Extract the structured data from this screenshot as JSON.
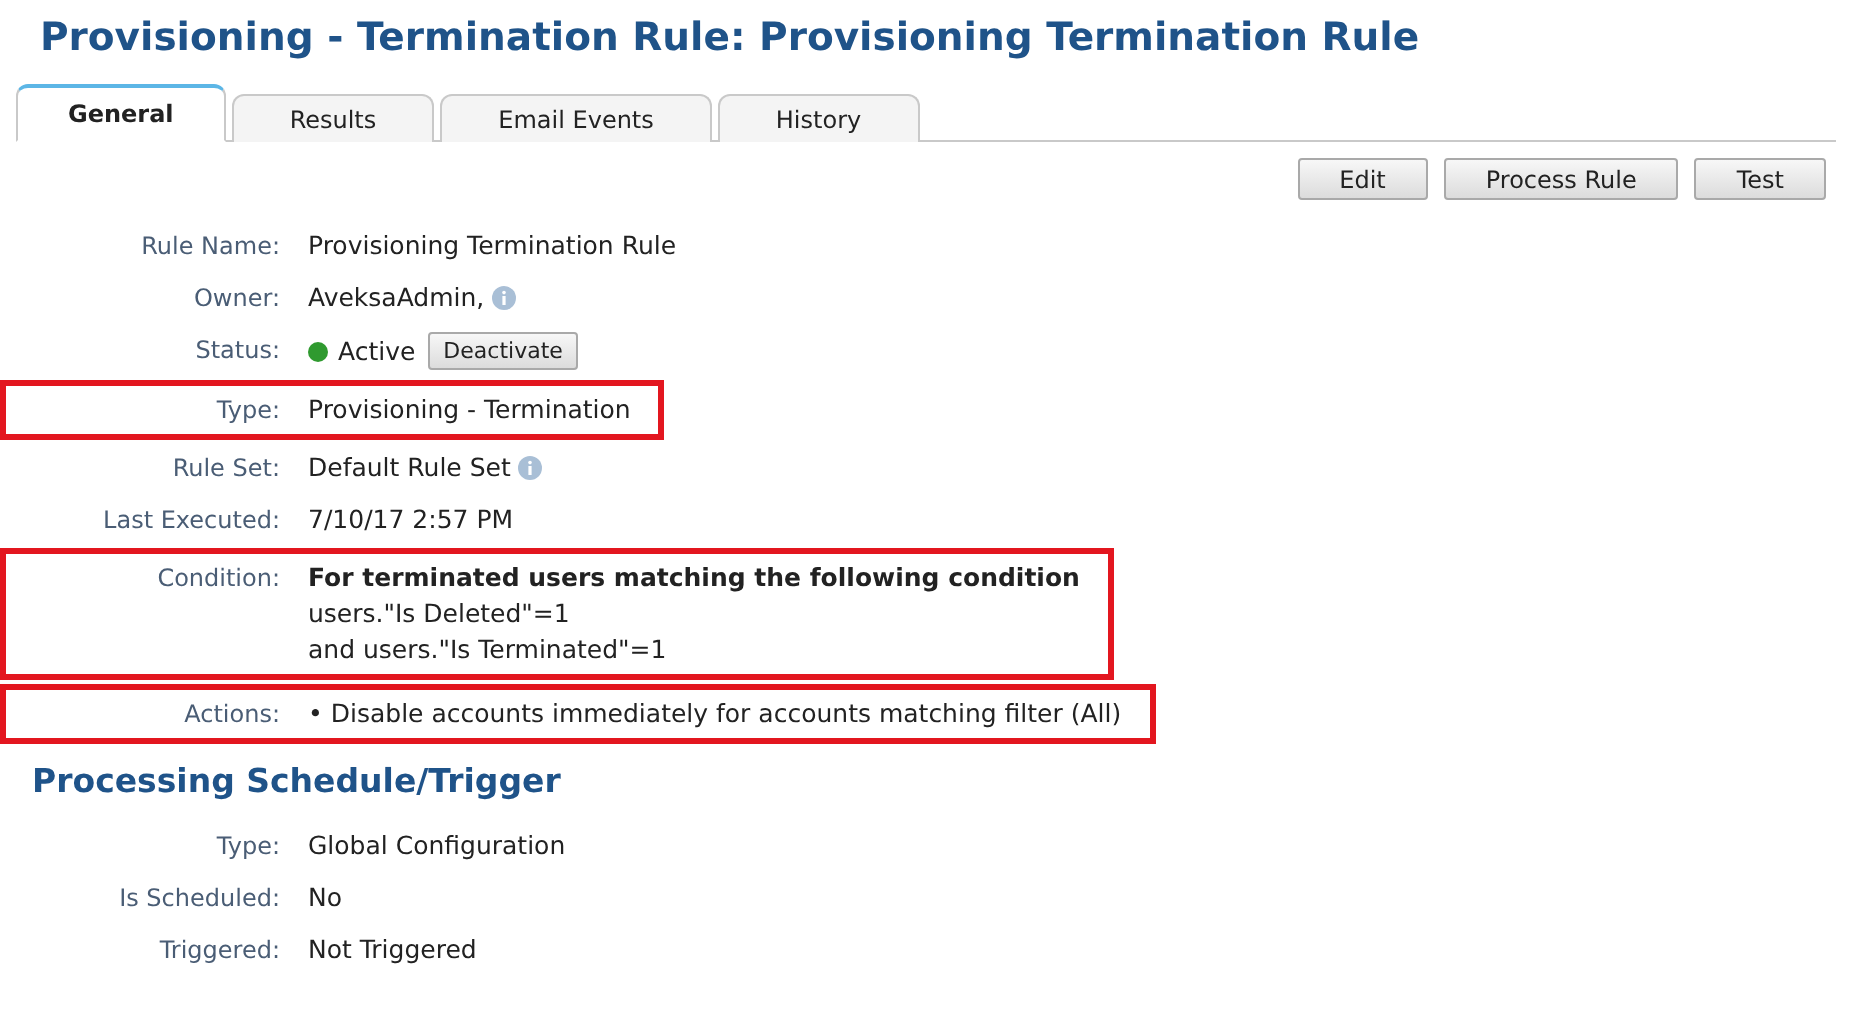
{
  "title": "Provisioning - Termination Rule: Provisioning Termination Rule",
  "tabs": [
    {
      "label": "General",
      "selected": true
    },
    {
      "label": "Results",
      "selected": false
    },
    {
      "label": "Email Events",
      "selected": false
    },
    {
      "label": "History",
      "selected": false
    }
  ],
  "actions": [
    "Edit",
    "Process Rule",
    "Test"
  ],
  "details": [
    {
      "kind": "text",
      "label": "Rule Name:",
      "value": "Provisioning Termination Rule",
      "info": false,
      "highlighted": false
    },
    {
      "kind": "text",
      "label": "Owner:",
      "value": "AveksaAdmin,",
      "info": true,
      "highlighted": false
    },
    {
      "kind": "status",
      "label": "Status:",
      "value": "Active",
      "active": true,
      "button": "Deactivate",
      "highlighted": false
    },
    {
      "kind": "text",
      "label": "Type:",
      "value": "Provisioning - Termination",
      "info": false,
      "highlighted": true
    },
    {
      "kind": "text",
      "label": "Rule Set:",
      "value": "Default Rule Set",
      "info": true,
      "highlighted": false
    },
    {
      "kind": "text",
      "label": "Last Executed:",
      "value": "7/10/17 2:57 PM",
      "info": false,
      "highlighted": false
    },
    {
      "kind": "condition",
      "label": "Condition:",
      "heading": "For terminated users matching the following condition",
      "lines": [
        "users.\"Is Deleted\"=1",
        "and users.\"Is Terminated\"=1"
      ],
      "highlighted": true
    },
    {
      "kind": "actions",
      "label": "Actions:",
      "bullet": "•",
      "items": [
        "Disable accounts immediately for accounts matching filter (All)"
      ],
      "highlighted": true
    }
  ],
  "schedule": {
    "heading": "Processing Schedule/Trigger",
    "fields": [
      {
        "label": "Type:",
        "value": "Global Configuration"
      },
      {
        "label": "Is Scheduled:",
        "value": "No"
      },
      {
        "label": "Triggered:",
        "value": "Not Triggered"
      }
    ]
  }
}
